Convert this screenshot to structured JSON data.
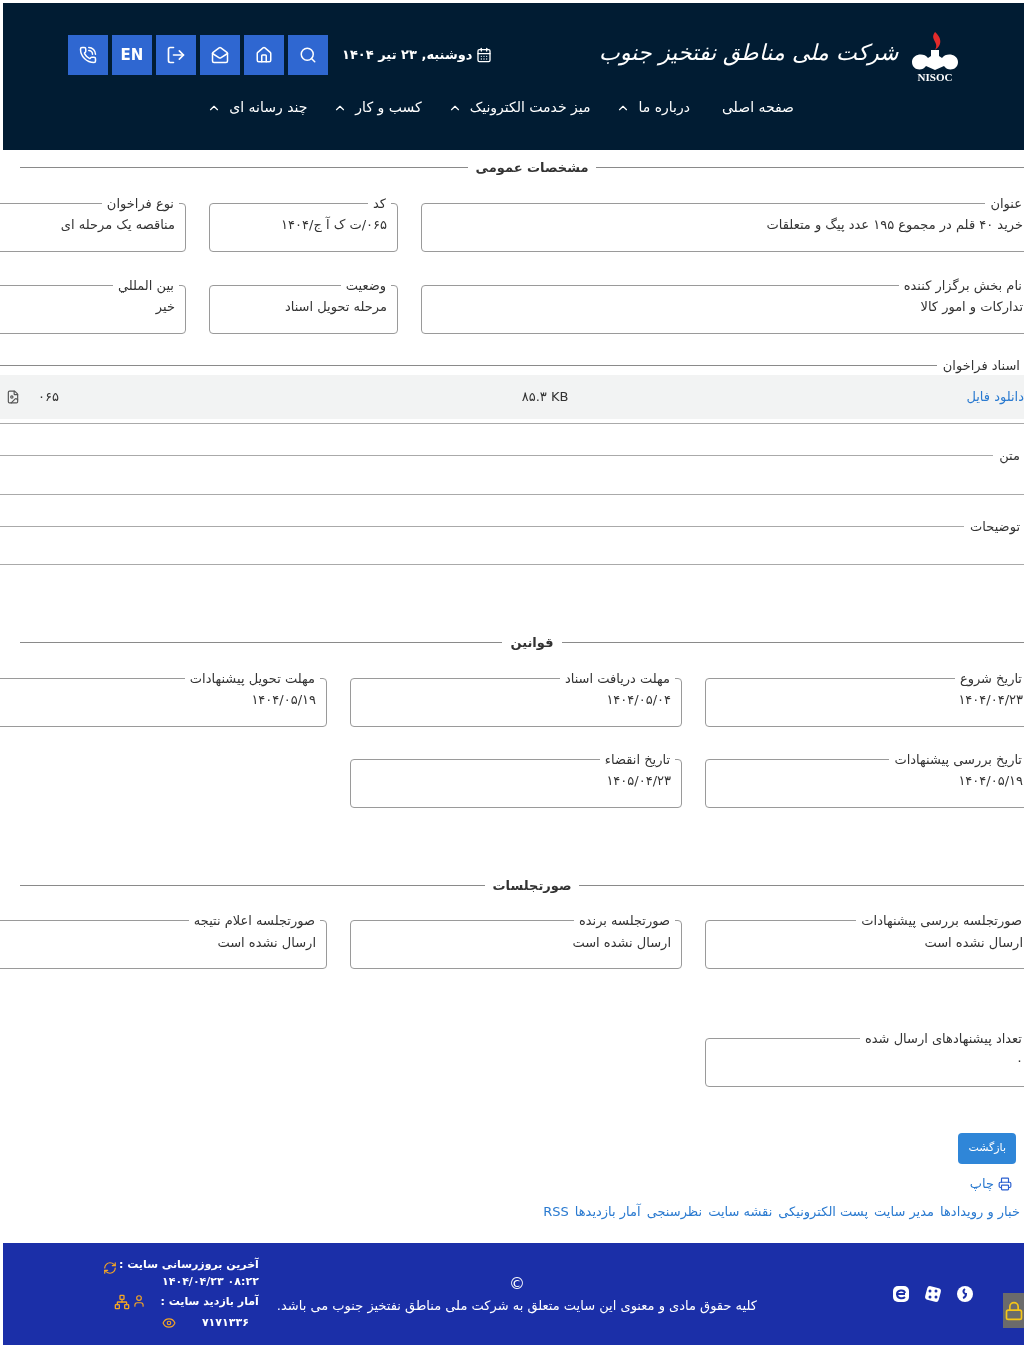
{
  "header": {
    "logo_text": "شرکت ملی مناطق نفتخیز جنوب",
    "logo_caption": "NISOC",
    "date": "دوشنبه, ۲۳ تیر ۱۴۰۴",
    "buttons": [
      {
        "kind": "search"
      },
      {
        "kind": "home"
      },
      {
        "kind": "mail"
      },
      {
        "kind": "logout"
      },
      {
        "kind": "text",
        "label": "EN"
      },
      {
        "kind": "phone"
      }
    ],
    "nav": [
      {
        "label": "صفحه اصلی",
        "has_menu": false
      },
      {
        "label": "درباره ما",
        "has_menu": true
      },
      {
        "label": "میز خدمت الکترونیک",
        "has_menu": true
      },
      {
        "label": "کسب و کار",
        "has_menu": true
      },
      {
        "label": "چند رسانه ای",
        "has_menu": true
      }
    ]
  },
  "general": {
    "title": "مشخصات عمومی",
    "rows": [
      [
        {
          "label": "عنوان",
          "value": "خرید ۴۰ قلم در مجموع ۱۹۵ عدد پیگ و متعلقات"
        },
        {
          "label": "کد",
          "value": "۰۶۵/ت ک آ ج/۱۴۰۴"
        },
        {
          "label": "نوع فراخوان",
          "value": "مناقصه یک مرحله ای"
        }
      ],
      [
        {
          "label": "نام بخش برگزار کننده",
          "value": "تدارکات و امور کالا"
        },
        {
          "label": "وضعیت",
          "value": "مرحله تحویل اسناد"
        },
        {
          "label": "بين المللي",
          "value": "خیر"
        }
      ]
    ]
  },
  "documents": {
    "label": "اسناد فراخوان",
    "files": [
      {
        "link": "دانلود فایل",
        "size": "۸۵.۳ KB",
        "name": "۰۶۵"
      }
    ]
  },
  "text_sections": [
    {
      "label": "متن"
    },
    {
      "label": "توضیحات"
    }
  ],
  "laws": {
    "title": "قوانین",
    "rows": [
      [
        {
          "label": "تاریخ شروع",
          "value": "۱۴۰۴/۰۴/۲۳"
        },
        {
          "label": "مهلت دریافت اسناد",
          "value": "۱۴۰۴/۰۵/۰۴"
        },
        {
          "label": "مهلت تحویل پیشنهادات",
          "value": "۱۴۰۴/۰۵/۱۹"
        }
      ],
      [
        {
          "label": "تاریخ بررسی پیشنهادات",
          "value": "۱۴۰۴/۰۵/۱۹"
        },
        {
          "label": "تاریخ انقضاء",
          "value": "۱۴۰۵/۰۴/۲۳"
        }
      ]
    ]
  },
  "minutes": {
    "title": "صورتجلسات",
    "rows": [
      [
        {
          "label": "صورتجلسه بررسی پیشنهادات",
          "value": "ارسال نشده است"
        },
        {
          "label": "صورتجلسه برنده",
          "value": "ارسال نشده است"
        },
        {
          "label": "صورتجلسه اعلام نتیجه",
          "value": "ارسال نشده است"
        }
      ]
    ],
    "count": {
      "label": "تعداد پیشنهادهای ارسال شده",
      "value": "۰"
    }
  },
  "actions": {
    "back": "بازگشت",
    "print": "چاپ"
  },
  "links": [
    "خبار و رویدادها",
    "مدیر سایت",
    "پست الکترونیکی",
    "نقشه سایت",
    "نظرسنجی",
    "آمار بازدیدها",
    "RSS"
  ],
  "footer": {
    "copyright": "©",
    "text": "کلیه حقوق مادی و معنوی این سایت متعلق به شرکت ملی مناطق نفتخیز جنوب می باشد.",
    "last_update_label": "آخرین بروزرسانی سایت :",
    "last_update": "۰۸:۲۲ ۱۴۰۴/۰۴/۲۳",
    "visits_label": "آمار بازدید سایت :",
    "visits": "۷۱۷۱۳۳۶"
  }
}
